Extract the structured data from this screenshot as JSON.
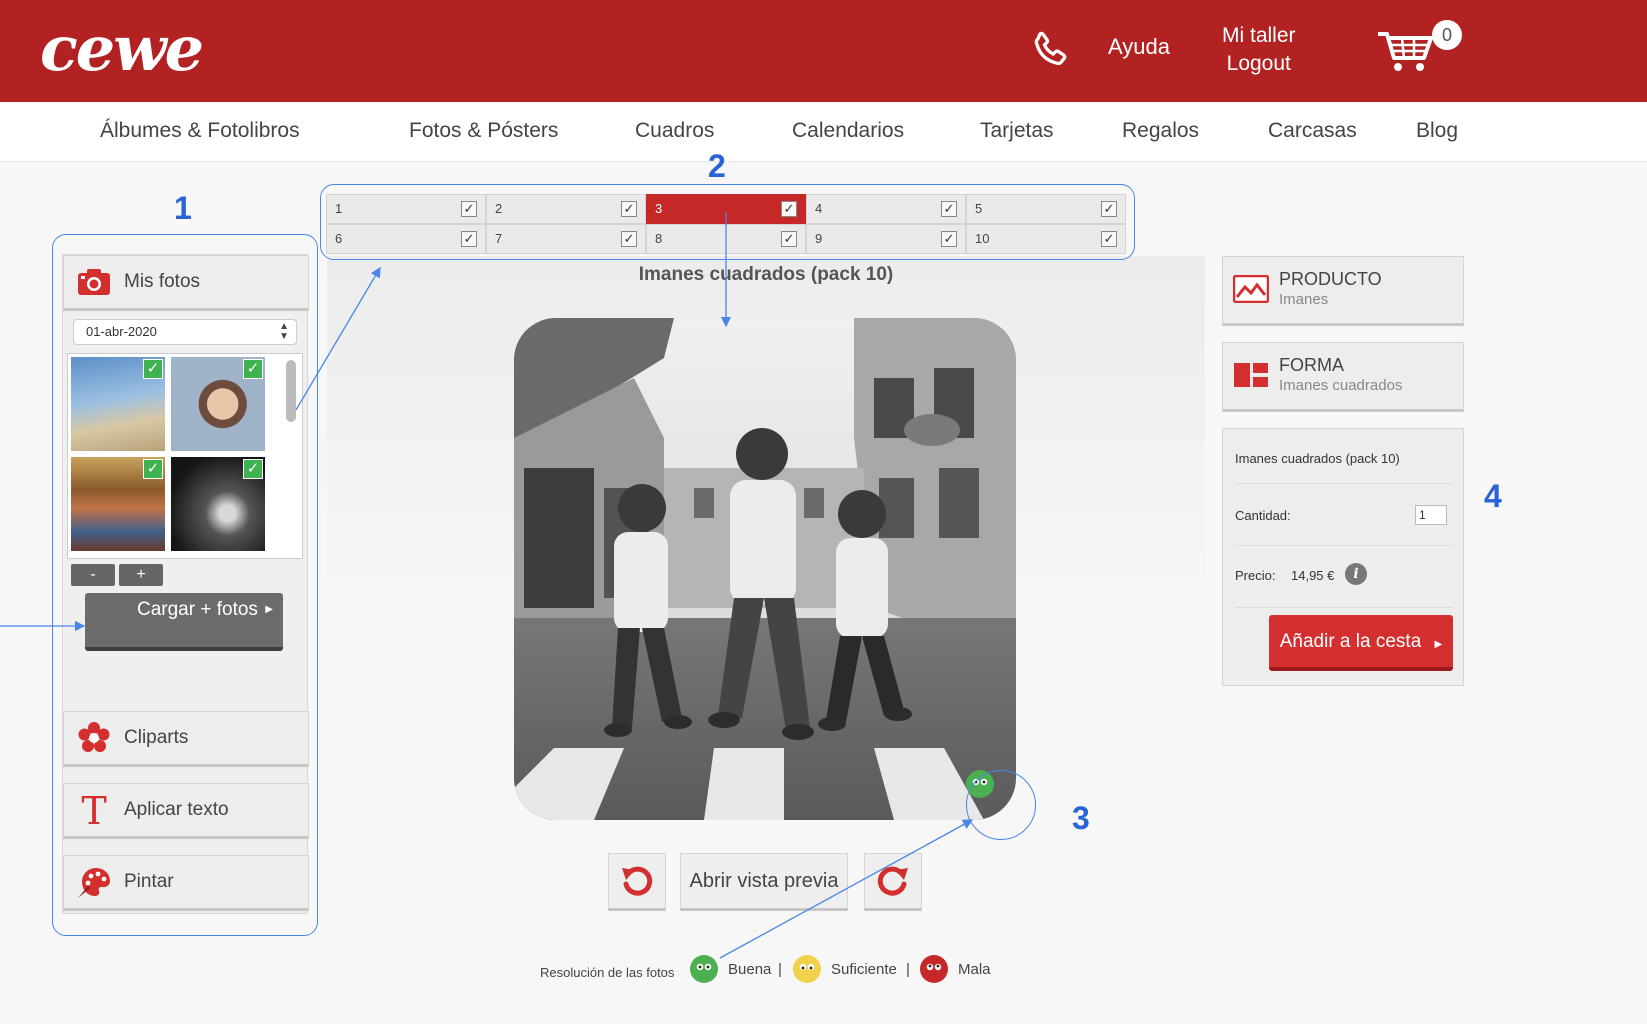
{
  "header": {
    "logo": "cewe",
    "help_label": "Ayuda",
    "account_label": "Mi taller",
    "logout_label": "Logout",
    "cart_count": "0"
  },
  "nav": {
    "items": [
      "Álbumes & Fotolibros",
      "Fotos & Pósters",
      "Cuadros",
      "Calendarios",
      "Tarjetas",
      "Regalos",
      "Carcasas",
      "Blog"
    ]
  },
  "annotations": [
    "1",
    "2",
    "3",
    "4"
  ],
  "left_panel": {
    "my_photos_label": "Mis fotos",
    "date_value": "01-abr-2020",
    "zoom_out_label": "-",
    "zoom_in_label": "+",
    "upload_label": "Cargar + fotos",
    "cliparts_label": "Cliparts",
    "text_label": "Aplicar texto",
    "paint_label": "Pintar"
  },
  "pages": {
    "tabs": [
      "1",
      "2",
      "3",
      "4",
      "5",
      "6",
      "7",
      "8",
      "9",
      "10"
    ],
    "active": "3"
  },
  "canvas": {
    "title": "Imanes cuadrados (pack 10)",
    "preview_label": "Abrir vista previa"
  },
  "legend": {
    "label": "Resolución de las fotos",
    "good": "Buena",
    "sufficient": "Suficiente",
    "bad": "Mala",
    "separator": "|"
  },
  "right_panel": {
    "product_title": "PRODUCTO",
    "product_sub": "Imanes",
    "shape_title": "FORMA",
    "shape_sub": "Imanes cuadrados",
    "order_title": "Imanes cuadrados (pack 10)",
    "quantity_label": "Cantidad:",
    "quantity_value": "1",
    "price_label": "Precio:",
    "price_value": "14,95 €",
    "info_glyph": "i",
    "add_to_cart_label": "Añadir a la cesta"
  },
  "colors": {
    "brand_red": "#b22222",
    "annotation_blue": "#4a86e8",
    "check_green": "#3fb34f"
  }
}
